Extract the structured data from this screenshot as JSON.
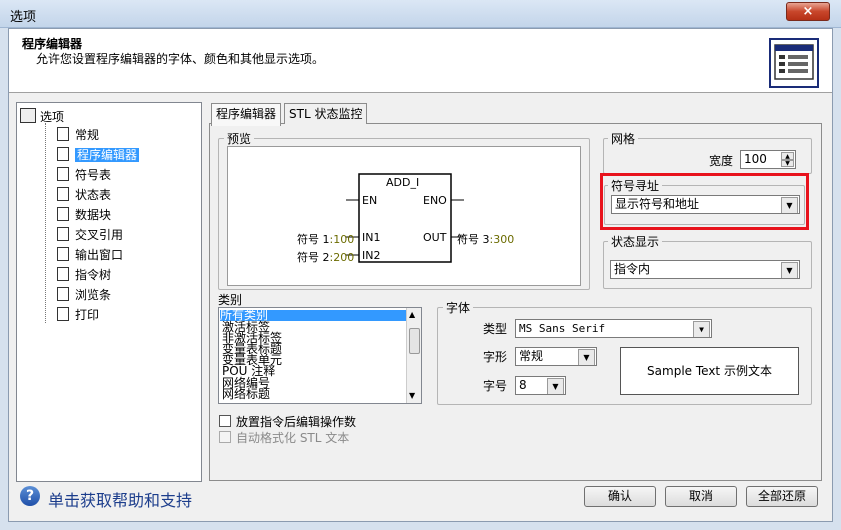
{
  "window": {
    "title": "选项",
    "close_symbol": "×"
  },
  "header": {
    "title": "程序编辑器",
    "description": "允许您设置程序编辑器的字体、颜色和其他显示选项。",
    "icon": "editor-settings-icon"
  },
  "tree": {
    "root": "选项",
    "items": [
      {
        "label": "常规",
        "selected": false
      },
      {
        "label": "程序编辑器",
        "selected": true
      },
      {
        "label": "符号表",
        "selected": false
      },
      {
        "label": "状态表",
        "selected": false
      },
      {
        "label": "数据块",
        "selected": false
      },
      {
        "label": "交叉引用",
        "selected": false
      },
      {
        "label": "输出窗口",
        "selected": false
      },
      {
        "label": "指令树",
        "selected": false
      },
      {
        "label": "浏览条",
        "selected": false
      },
      {
        "label": "打印",
        "selected": false
      }
    ]
  },
  "tabs": [
    {
      "label": "程序编辑器",
      "active": true
    },
    {
      "label": "STL 状态监控",
      "active": false
    }
  ],
  "preview": {
    "label": "预览",
    "block_name": "ADD_I",
    "en": "EN",
    "eno": "ENO",
    "in1": "IN1",
    "in2": "IN2",
    "out": "OUT",
    "sym1_name": "符号 1",
    "sym1_addr": ":100",
    "sym2_name": "符号 2",
    "sym2_addr": ":200",
    "sym3_name": "符号 3",
    "sym3_addr": ":300",
    "addr_color": "#6b6b00"
  },
  "grid": {
    "label": "网格",
    "width_label": "宽度",
    "width_value": "100"
  },
  "symbol_addressing": {
    "label": "符号寻址",
    "value": "显示符号和地址",
    "highlight_color": "#e8121c"
  },
  "status_display": {
    "label": "状态显示",
    "value": "指令内"
  },
  "category": {
    "label": "类别",
    "items": [
      "所有类别",
      "激活标签",
      "非激活标签",
      "变量表标题",
      "变量表单元",
      "POU 注释",
      "网络编号",
      "网络标题"
    ],
    "selected_index": 0
  },
  "font": {
    "label": "字体",
    "type_label": "类型",
    "type_value": "MS Sans Serif",
    "style_label": "字形",
    "style_value": "常规",
    "size_label": "字号",
    "size_value": "8",
    "sample_text": "Sample Text 示例文本"
  },
  "options": {
    "place_instruction": "放置指令后编辑操作数",
    "auto_format": "自动格式化 STL 文本"
  },
  "footer": {
    "help_text": "单击获取帮助和支持",
    "ok": "确认",
    "cancel": "取消",
    "restore": "全部还原"
  }
}
